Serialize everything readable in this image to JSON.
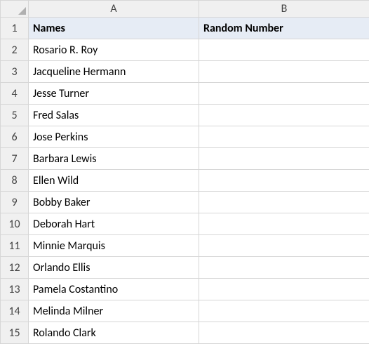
{
  "columns": {
    "A": "A",
    "B": "B"
  },
  "rowNumbers": [
    "1",
    "2",
    "3",
    "4",
    "5",
    "6",
    "7",
    "8",
    "9",
    "10",
    "11",
    "12",
    "13",
    "14",
    "15"
  ],
  "headers": {
    "A": "Names",
    "B": "Random Number"
  },
  "rows": [
    {
      "A": "Rosario R. Roy",
      "B": ""
    },
    {
      "A": "Jacqueline Hermann",
      "B": ""
    },
    {
      "A": "Jesse Turner",
      "B": ""
    },
    {
      "A": "Fred Salas",
      "B": ""
    },
    {
      "A": "Jose Perkins",
      "B": ""
    },
    {
      "A": "Barbara Lewis",
      "B": ""
    },
    {
      "A": "Ellen Wild",
      "B": ""
    },
    {
      "A": "Bobby Baker",
      "B": ""
    },
    {
      "A": "Deborah Hart",
      "B": ""
    },
    {
      "A": "Minnie Marquis",
      "B": ""
    },
    {
      "A": "Orlando Ellis",
      "B": ""
    },
    {
      "A": "Pamela Costantino",
      "B": ""
    },
    {
      "A": "Melinda Milner",
      "B": ""
    },
    {
      "A": "Rolando Clark",
      "B": ""
    }
  ]
}
